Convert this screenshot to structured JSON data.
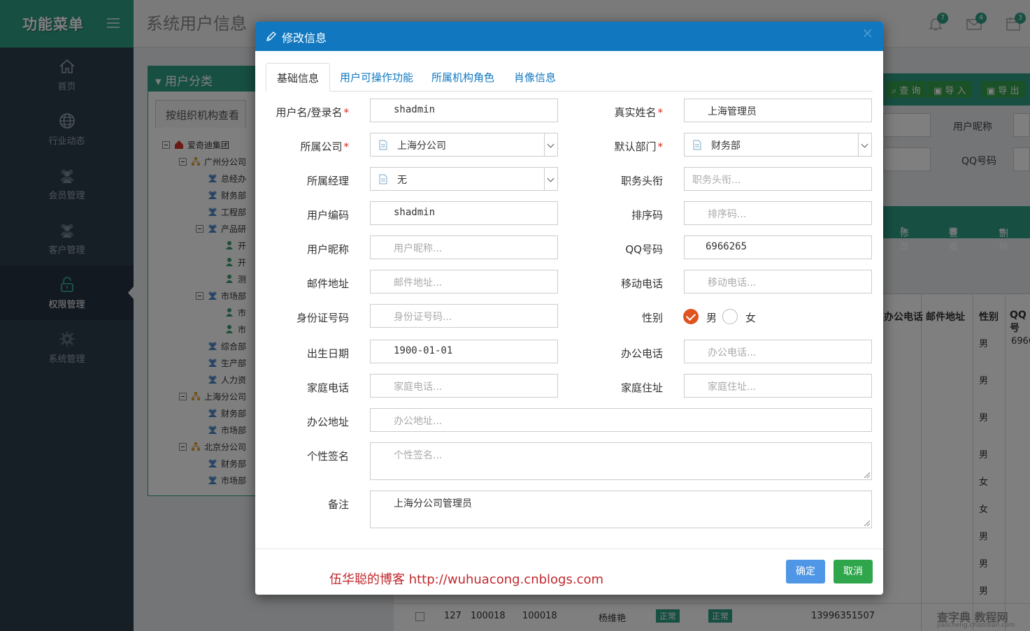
{
  "sidebar": {
    "brand": "功能菜单",
    "items": [
      {
        "label": "首页",
        "icon": "home-icon"
      },
      {
        "label": "行业动态",
        "icon": "globe-icon"
      },
      {
        "label": "会员管理",
        "icon": "users-icon"
      },
      {
        "label": "客户管理",
        "icon": "users-icon"
      },
      {
        "label": "权限管理",
        "icon": "lock-icon",
        "active": true
      },
      {
        "label": "系统管理",
        "icon": "gear-icon"
      }
    ]
  },
  "header": {
    "page_title": "系统用户信息",
    "badges": {
      "bell": "7",
      "mail": "4",
      "calendar": "3"
    }
  },
  "tree": {
    "title": "用户分类",
    "tab": "按组织机构查看",
    "nodes": [
      "爱奇迪集团",
      "广州分公司",
      "总经办",
      "财务部",
      "工程部",
      "产品研",
      "开",
      "开",
      "测",
      "市场部",
      "市",
      "市",
      "综合部",
      "生产部",
      "人力资",
      "上海分公司",
      "财务部",
      "市场部",
      "北京分公司",
      "财务部",
      "市场部"
    ]
  },
  "background": {
    "buttons": {
      "query": "查 询",
      "import": "导 入",
      "export": "导 出"
    },
    "labels": {
      "nickname": "用户昵称",
      "qq": "QQ号码"
    },
    "actions": {
      "edit": "修改",
      "view": "查看",
      "delete": "删除"
    },
    "columns": {
      "office_phone": "办公电话",
      "email": "邮件地址",
      "gender": "性别",
      "qq": "QQ号"
    },
    "genders": [
      "男",
      "男",
      "男",
      "男",
      "女",
      "女",
      "男",
      "男",
      "男"
    ],
    "first_qq": "6966",
    "last_row": {
      "id": "127",
      "code1": "100018",
      "code2": "100018",
      "name": "杨维艳",
      "status1": "正常",
      "status2": "正常",
      "phone": "13996351507"
    }
  },
  "modal": {
    "title": "修改信息",
    "close": "×",
    "tabs": [
      "基础信息",
      "用户可操作功能",
      "所属机构角色",
      "肖像信息"
    ],
    "fields": {
      "username": {
        "label": "用户名/登录名",
        "value": "shadmin"
      },
      "realname": {
        "label": "真实姓名",
        "value": "上海管理员"
      },
      "company": {
        "label": "所属公司",
        "value": "上海分公司"
      },
      "dept": {
        "label": "默认部门",
        "value": "财务部"
      },
      "manager": {
        "label": "所属经理",
        "value": "无"
      },
      "jobtitle": {
        "label": "职务头衔",
        "placeholder": "职务头衔..."
      },
      "usercode": {
        "label": "用户编码",
        "value": "shadmin"
      },
      "sortcode": {
        "label": "排序码",
        "placeholder": "排序码..."
      },
      "nickname": {
        "label": "用户昵称",
        "placeholder": "用户昵称..."
      },
      "qq": {
        "label": "QQ号码",
        "value": "6966265"
      },
      "email": {
        "label": "邮件地址",
        "placeholder": "邮件地址..."
      },
      "mobile": {
        "label": "移动电话",
        "placeholder": "移动电话..."
      },
      "idcard": {
        "label": "身份证号码",
        "placeholder": "身份证号码..."
      },
      "gender": {
        "label": "性别",
        "male": "男",
        "female": "女",
        "selected": "男"
      },
      "birthday": {
        "label": "出生日期",
        "value": "1900-01-01"
      },
      "officephone": {
        "label": "办公电话",
        "placeholder": "办公电话..."
      },
      "homephone": {
        "label": "家庭电话",
        "placeholder": "家庭电话..."
      },
      "homeaddr": {
        "label": "家庭住址",
        "placeholder": "家庭住址..."
      },
      "officeaddr": {
        "label": "办公地址",
        "placeholder": "办公地址..."
      },
      "signature": {
        "label": "个性签名",
        "placeholder": "个性签名..."
      },
      "remark": {
        "label": "备注",
        "value": "上海分公司管理员"
      }
    },
    "footer": {
      "blog": "伍华聪的博客  http://wuhuacong.cnblogs.com",
      "ok": "确定",
      "cancel": "取消"
    }
  },
  "corner": {
    "mark": "查字典 教程网",
    "url": "jiaocheng.chazidian.com"
  },
  "colors": {
    "teal": "#2e9e86",
    "modal_header": "#1178c0",
    "radio_checked": "#e0531f",
    "ok_button": "#4f97e6",
    "cancel_button": "#2fa64b"
  }
}
